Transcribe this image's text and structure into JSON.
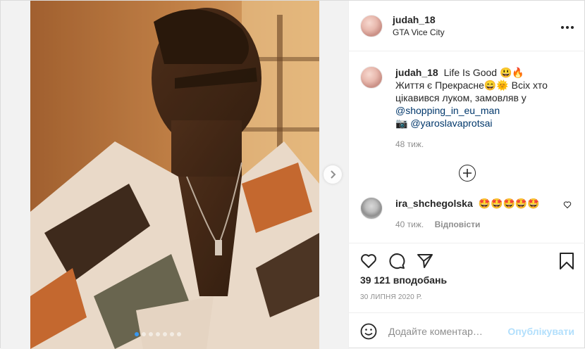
{
  "post": {
    "author": "judah_18",
    "location": "GTA Vice City",
    "more_icon": "⋯"
  },
  "media": {
    "photo_description_icon": "photo",
    "carousel_total": 7,
    "carousel_active": 1,
    "accent": "#3897f0"
  },
  "caption": {
    "author": "judah_18",
    "text_1": "Life Is Good 😃🔥",
    "text_2": "Життя є Прекрасне😄🌞 Всіх хто цікавився луком, замовляв у ",
    "mention_1": "@shopping_in_eu_man",
    "camera_emoji": "📷",
    "mention_2": "@yaroslavaprotsai",
    "time": "48 тиж."
  },
  "comments": [
    {
      "author": "ira_shchegolska",
      "text": "🤩🤩🤩🤩🤩",
      "time": "40 тиж.",
      "reply_label": "Відповісти"
    }
  ],
  "load_more_symbol": "+",
  "stats": {
    "likes": "39 121 вподобань",
    "date": "30 ЛИПНЯ 2020 Р."
  },
  "composer": {
    "placeholder": "Додайте коментар…",
    "publish_label": "Опублікувати",
    "publish_color": "#b2dffc"
  }
}
